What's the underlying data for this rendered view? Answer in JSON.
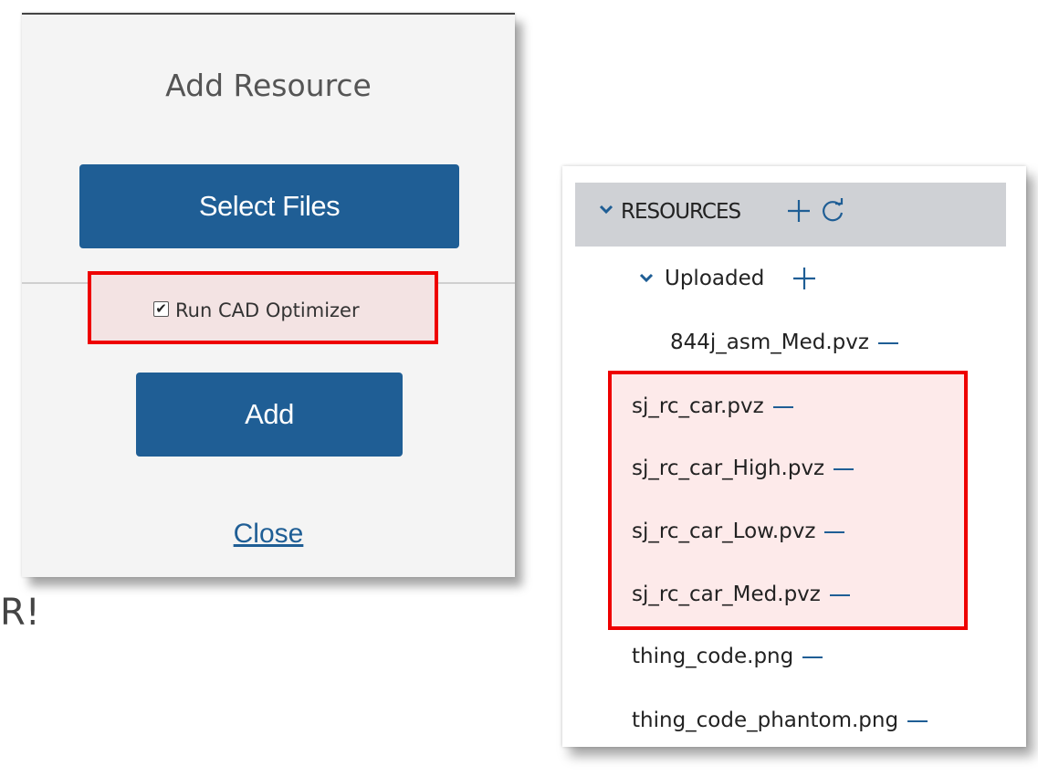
{
  "dialog": {
    "title": "Add Resource",
    "select_files_label": "Select Files",
    "optimizer_checkbox_label": "Run CAD Optimizer",
    "optimizer_checked": true,
    "add_label": "Add",
    "close_label": "Close"
  },
  "side_text": "R!",
  "resources": {
    "header_label": "RESOURCES",
    "folder_label": "Uploaded",
    "files": [
      "844j_asm_Med.pvz",
      "sj_rc_car.pvz",
      "sj_rc_car_High.pvz",
      "sj_rc_car_Low.pvz",
      "sj_rc_car_Med.pvz",
      "thing_code.png",
      "thing_code_phantom.png"
    ]
  },
  "colors": {
    "accent": "#1f5e95",
    "highlight_border": "#ee0000",
    "highlight_fill": "#fdeaea",
    "header_bg": "#cfd1d5"
  },
  "icons": [
    "chevron-down-icon",
    "plus-icon",
    "refresh-icon",
    "minus-icon",
    "checkbox-icon"
  ]
}
